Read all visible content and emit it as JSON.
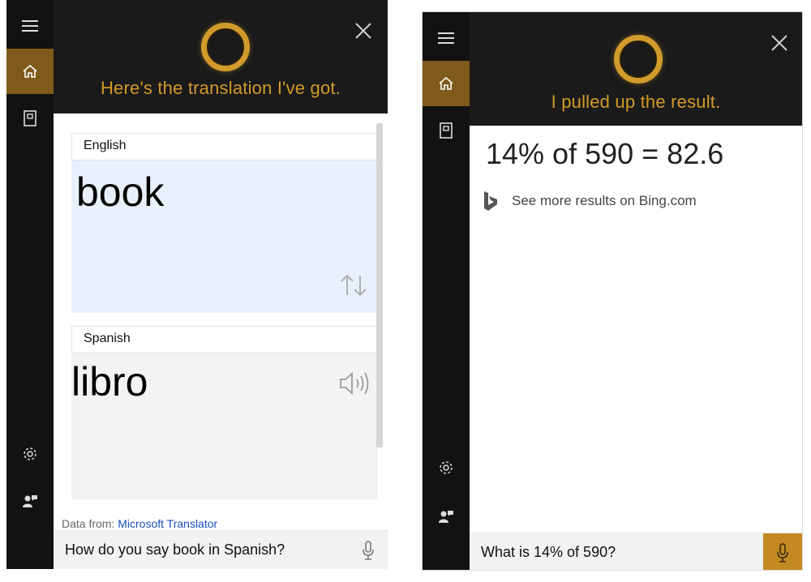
{
  "translation_panel": {
    "header_text": "Here's the translation I've got.",
    "source": {
      "language": "English",
      "word": "book"
    },
    "target": {
      "language": "Spanish",
      "word": "libro"
    },
    "attribution": {
      "prefix": "Data from:",
      "link": "Microsoft Translator"
    },
    "query": "How do you say book in Spanish?"
  },
  "calculator_panel": {
    "header_text": "I pulled up the result.",
    "result": "14% of 590 = 82.6",
    "bing_link": "See more results on Bing.com",
    "query": "What is 14% of 590?"
  },
  "theme": {
    "accent": "#d19b2c",
    "active_rail": "#7f5a1a",
    "rail_bg": "#121212",
    "header_bg": "#1a1a1a",
    "source_bg": "#e8f1fb"
  },
  "icons": {
    "menu": "hamburger-icon",
    "home": "home-icon",
    "notebook": "notebook-icon",
    "settings": "gear-icon",
    "feedback": "feedback-icon",
    "close": "close-icon",
    "swap": "swap-arrows-icon",
    "speaker": "speaker-icon",
    "mic": "microphone-icon",
    "bing": "bing-logo-icon"
  }
}
